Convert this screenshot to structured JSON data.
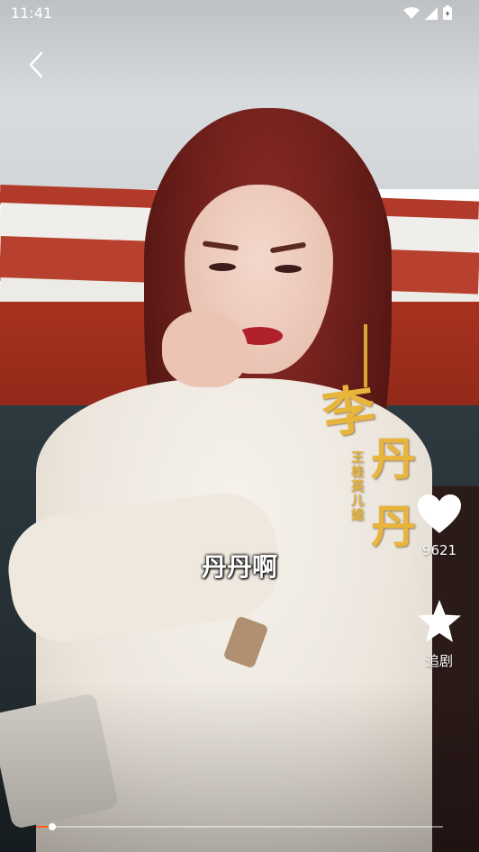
{
  "status_bar": {
    "time": "11:41",
    "icons": [
      "wifi-icon",
      "signal-icon",
      "battery-icon"
    ]
  },
  "player": {
    "back_icon": "chevron-left-icon",
    "subtitle": "丹丹啊",
    "title_overlay": {
      "line1": "李",
      "line2": "丹",
      "line3": "丹",
      "vertical": "王桂英儿媳"
    },
    "progress_fraction": 0.04,
    "accent_color": "#ff5a1f"
  },
  "actions": {
    "like": {
      "icon": "heart-icon",
      "count": "9621"
    },
    "follow": {
      "icon": "star-icon",
      "label": "追剧"
    }
  }
}
